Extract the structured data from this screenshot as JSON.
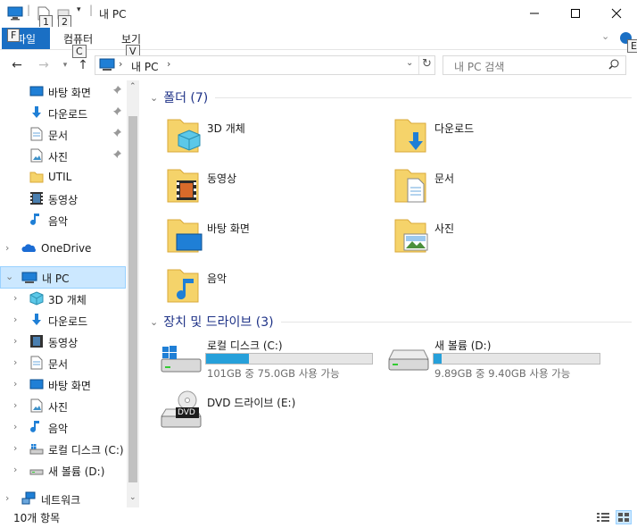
{
  "window": {
    "title": "내 PC",
    "qat_tips": [
      "1",
      "2"
    ],
    "help_tip": "E"
  },
  "ribbon": {
    "file_label": "파일",
    "file_tip": "F",
    "tabs": [
      {
        "label": "컴퓨터",
        "tip": "C"
      },
      {
        "label": "보기",
        "tip": "V"
      }
    ]
  },
  "address": {
    "path": "내 PC",
    "search_placeholder": "내 PC 검색"
  },
  "nav": {
    "quick": [
      {
        "label": "바탕 화면",
        "icon": "desktop-icon",
        "pinned": true
      },
      {
        "label": "다운로드",
        "icon": "download-icon",
        "pinned": true
      },
      {
        "label": "문서",
        "icon": "document-icon",
        "pinned": true
      },
      {
        "label": "사진",
        "icon": "pictures-icon",
        "pinned": true
      },
      {
        "label": "UTIL",
        "icon": "folder-icon",
        "pinned": false
      },
      {
        "label": "동영상",
        "icon": "videos-icon",
        "pinned": false
      },
      {
        "label": "음악",
        "icon": "music-icon",
        "pinned": false
      }
    ],
    "onedrive": "OneDrive",
    "thispc": "내 PC",
    "pc_children": [
      {
        "label": "3D 개체",
        "icon": "3d-objects-icon"
      },
      {
        "label": "다운로드",
        "icon": "download-icon"
      },
      {
        "label": "동영상",
        "icon": "videos-icon"
      },
      {
        "label": "문서",
        "icon": "document-icon"
      },
      {
        "label": "바탕 화면",
        "icon": "desktop-icon"
      },
      {
        "label": "사진",
        "icon": "pictures-icon"
      },
      {
        "label": "음악",
        "icon": "music-icon"
      },
      {
        "label": "로컬 디스크 (C:)",
        "icon": "local-disk-icon"
      },
      {
        "label": "새 볼륨 (D:)",
        "icon": "drive-icon"
      }
    ],
    "network": "네트워크"
  },
  "content": {
    "folders_header": "폴더 (7)",
    "folders": [
      {
        "label": "3D 개체",
        "icon": "3d-objects-icon"
      },
      {
        "label": "다운로드",
        "icon": "download-icon"
      },
      {
        "label": "동영상",
        "icon": "videos-icon"
      },
      {
        "label": "문서",
        "icon": "document-icon"
      },
      {
        "label": "바탕 화면",
        "icon": "desktop-icon"
      },
      {
        "label": "사진",
        "icon": "pictures-icon"
      },
      {
        "label": "음악",
        "icon": "music-icon"
      }
    ],
    "devices_header": "장치 및 드라이브 (3)",
    "drives": [
      {
        "label": "로컬 디스크 (C:)",
        "info": "101GB 중 75.0GB 사용 가능",
        "used_fraction": 0.26,
        "icon": "windows-drive-icon"
      },
      {
        "label": "새 볼륨 (D:)",
        "info": "9.89GB 중 9.40GB 사용 가능",
        "used_fraction": 0.05,
        "icon": "drive-icon"
      },
      {
        "label": "DVD 드라이브 (E:)",
        "info": "",
        "icon": "dvd-drive-icon",
        "badge": "DVD"
      }
    ]
  },
  "status": {
    "item_count": "10개 항목"
  },
  "colors": {
    "accent": "#1a6fc4",
    "selection": "#cce8ff",
    "drive_fill": "#26a0da",
    "group_header": "#1e3287"
  }
}
